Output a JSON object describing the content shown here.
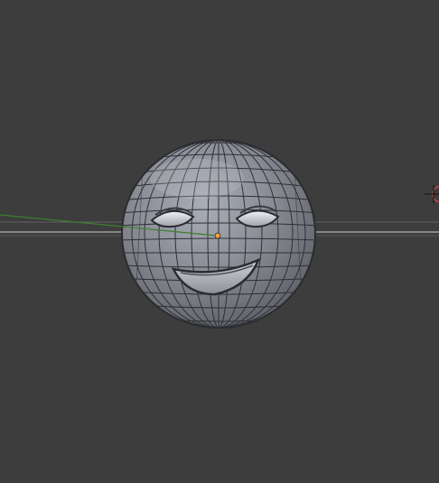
{
  "viewport": {
    "background": "#3d3d3d",
    "x_axis_color": "#9b9b9b",
    "y_axis_color": "#3b7f2d",
    "origin_color": "#f2a146",
    "light_indicator_color": "#c84a4a",
    "object": {
      "name": "smiley-face-mesh",
      "shape": "UV sphere with sculpted eyes and smile",
      "state": "selected, wireframe overlay"
    }
  }
}
